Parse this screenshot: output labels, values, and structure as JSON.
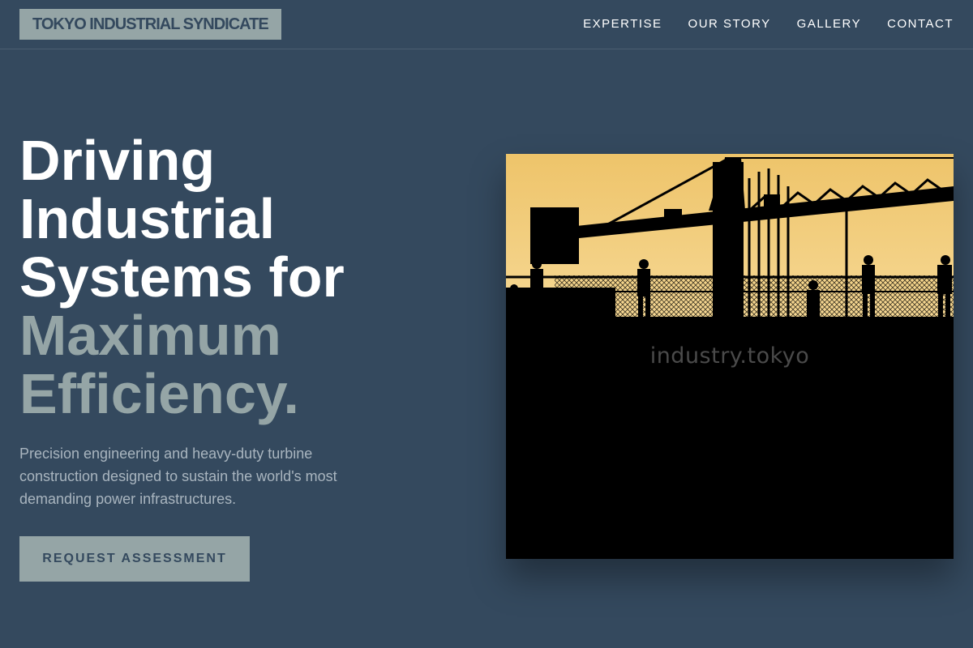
{
  "brand": {
    "name": "TOKYO INDUSTRIAL SYNDICATE"
  },
  "nav": {
    "items": [
      {
        "label": "EXPERTISE"
      },
      {
        "label": "OUR STORY"
      },
      {
        "label": "GALLERY"
      },
      {
        "label": "CONTACT"
      }
    ]
  },
  "hero": {
    "headline_lines": [
      "Driving",
      "Industrial",
      "Systems for"
    ],
    "headline_accent_lines": [
      "Maximum",
      "Efficiency."
    ],
    "description": "Precision engineering and heavy-duty turbine construction designed to sustain the world's most demanding power infrastructures.",
    "cta_label": "REQUEST ASSESSMENT",
    "image_watermark": "industry.tokyo"
  },
  "colors": {
    "background": "#34495e",
    "accent": "#95a5a6",
    "text": "#ffffff",
    "muted_text": "#a9b5bf",
    "sky": "#f1c76e"
  }
}
